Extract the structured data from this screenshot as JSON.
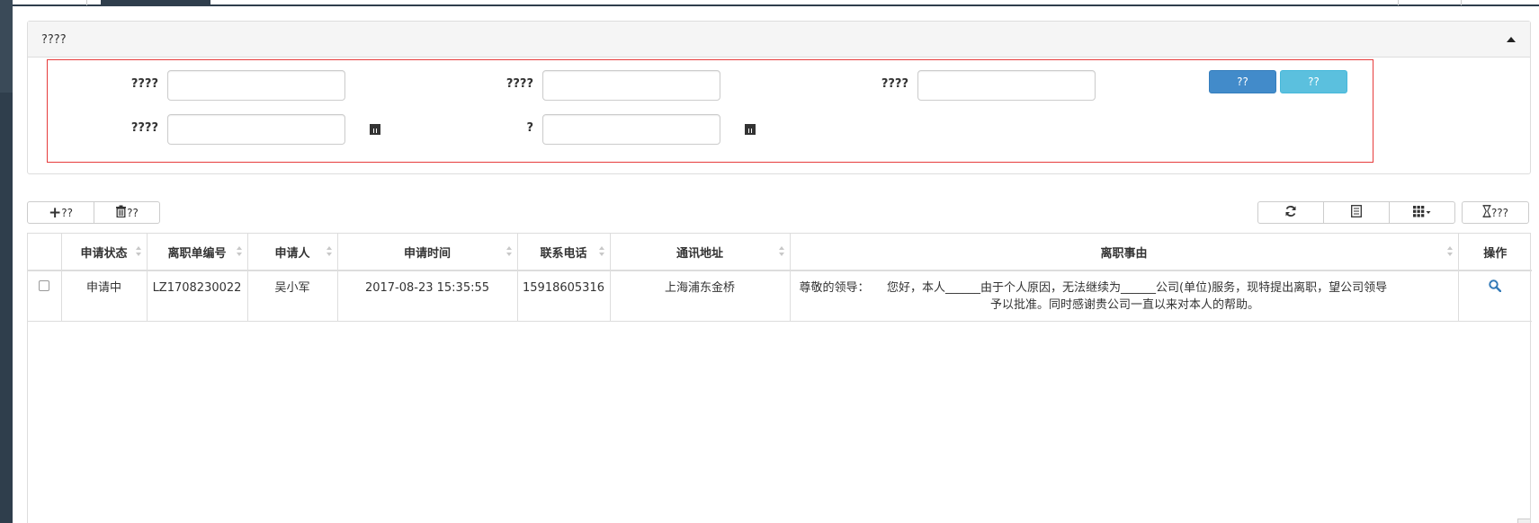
{
  "search_panel": {
    "title": "????",
    "fields": [
      {
        "label": "????",
        "value": "",
        "placeholder": ""
      },
      {
        "label": "????",
        "value": "",
        "placeholder": ""
      },
      {
        "label": "????",
        "value": "",
        "placeholder": ""
      },
      {
        "label": "????",
        "value": "",
        "placeholder": ""
      },
      {
        "label": "?",
        "value": "",
        "placeholder": ""
      }
    ],
    "search_button": "??",
    "reset_button": "??"
  },
  "toolbar": {
    "add_label": "??",
    "delete_label": "??",
    "export_label": "???"
  },
  "table": {
    "columns": [
      "申请状态",
      "离职单编号",
      "申请人",
      "申请时间",
      "联系电话",
      "通讯地址",
      "离职事由",
      "操作"
    ],
    "rows": [
      {
        "status": "申请中",
        "number": "LZ1708230022",
        "applicant": "吴小军",
        "time": "2017-08-23 15:35:55",
        "phone": "15918605316",
        "address": "上海浦东金桥",
        "reason_line1": "尊敬的领导：　　您好，本人______由于个人原因，无法继续为______公司(单位)服务，现特提出离职，望公司领导",
        "reason_line2": "予以批准。同时感谢贵公司一直以来对本人的帮助。"
      }
    ]
  },
  "colors": {
    "primary": "#428bca",
    "info": "#5bc0de",
    "sidebar": "#2f3e4c",
    "highlight_border": "#e63c3c"
  },
  "icons": [
    "caret-up-icon",
    "calendar-icon",
    "plus-icon",
    "trash-icon",
    "refresh-icon",
    "list-icon",
    "columns-grid-icon",
    "hourglass-icon",
    "search-icon"
  ]
}
